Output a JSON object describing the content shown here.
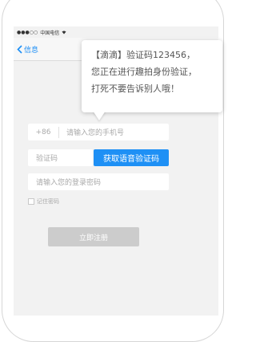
{
  "status_bar": {
    "signal_dots": "●●●○○",
    "carrier": "中国电信"
  },
  "nav": {
    "back_label": "信息"
  },
  "sms_bubble": {
    "line1": "【滴滴】验证码123456，",
    "line2": "您正在进行趣拍身份验证，",
    "line3": "打死不要告诉别人哦！"
  },
  "form": {
    "country_code": "+86",
    "phone_placeholder": "请输入您的手机号",
    "code_placeholder": "验证码",
    "voice_code_button": "获取语音验证码",
    "password_placeholder": "请输入您的登录密码",
    "remember_label": "记住密码",
    "register_button": "立即注册"
  },
  "colors": {
    "accent": "#1e90f5",
    "disabled_button": "#cccccc",
    "screen_bg": "#f2f2f2"
  }
}
